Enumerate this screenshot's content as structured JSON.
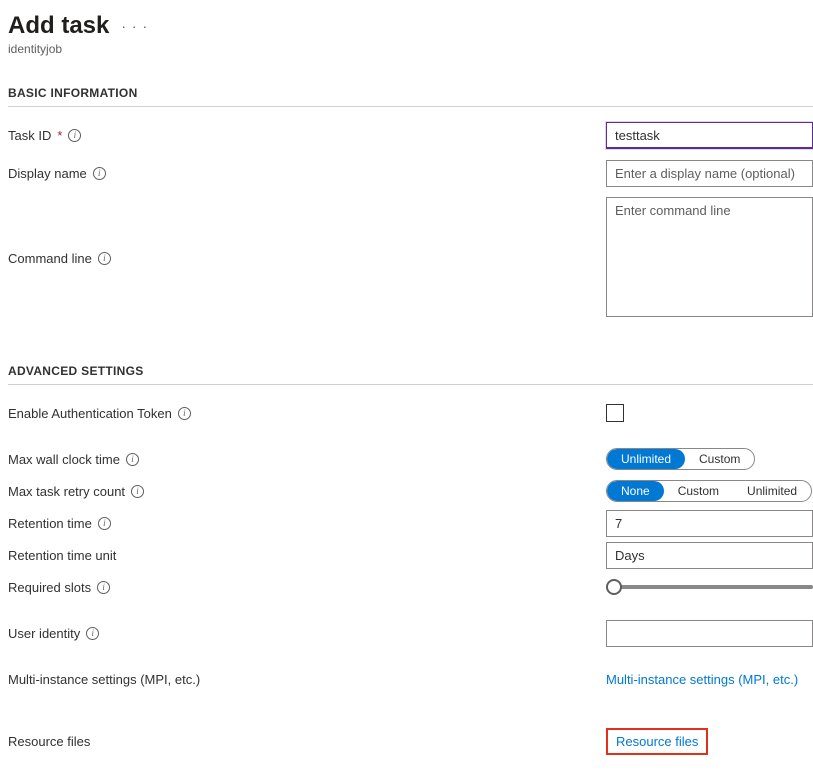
{
  "header": {
    "title": "Add task",
    "subtitle": "identityjob"
  },
  "sections": {
    "basic": "BASIC INFORMATION",
    "advanced": "ADVANCED SETTINGS"
  },
  "basic": {
    "task_id_label": "Task ID",
    "task_id_value": "testtask",
    "display_name_label": "Display name",
    "display_name_placeholder": "Enter a display name (optional)",
    "command_line_label": "Command line",
    "command_line_placeholder": "Enter command line"
  },
  "advanced": {
    "enable_auth_label": "Enable Authentication Token",
    "max_wall_label": "Max wall clock time",
    "wall_options": {
      "unlimited": "Unlimited",
      "custom": "Custom"
    },
    "max_retry_label": "Max task retry count",
    "retry_options": {
      "none": "None",
      "custom": "Custom",
      "unlimited": "Unlimited"
    },
    "retention_time_label": "Retention time",
    "retention_time_value": "7",
    "retention_unit_label": "Retention time unit",
    "retention_unit_value": "Days",
    "required_slots_label": "Required slots",
    "user_identity_label": "User identity",
    "mpi_label": "Multi-instance settings (MPI, etc.)",
    "mpi_link": "Multi-instance settings (MPI, etc.)",
    "resource_files_label": "Resource files",
    "resource_files_link": "Resource files"
  }
}
